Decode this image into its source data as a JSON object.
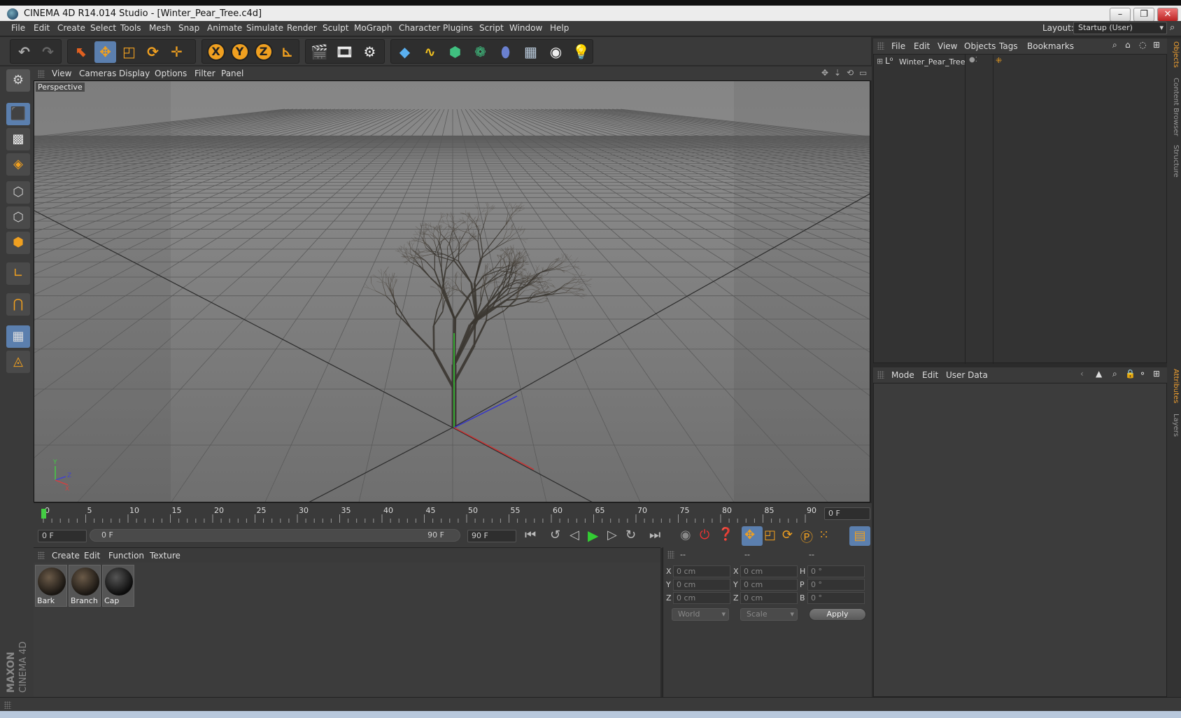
{
  "window": {
    "title": "CINEMA 4D R14.014 Studio - [Winter_Pear_Tree.c4d]",
    "controls": [
      "–",
      "❐",
      "✕"
    ]
  },
  "menu": [
    "File",
    "Edit",
    "Create",
    "Select",
    "Tools",
    "Mesh",
    "Snap",
    "Animate",
    "Simulate",
    "Render",
    "Sculpt",
    "MoGraph",
    "Character",
    "Plugins",
    "Script",
    "Window",
    "Help"
  ],
  "layout": {
    "label": "Layout:",
    "value": "Startup (User)"
  },
  "viewport": {
    "menu": [
      "View",
      "Cameras",
      "Display",
      "Options",
      "Filter",
      "Panel"
    ],
    "label": "Perspective",
    "axis_labels": {
      "y": "Y",
      "z": "Z",
      "x": "X"
    }
  },
  "timeline": {
    "ticks": [
      "0",
      "5",
      "10",
      "15",
      "20",
      "25",
      "30",
      "35",
      "40",
      "45",
      "50",
      "55",
      "60",
      "65",
      "70",
      "75",
      "80",
      "85",
      "90"
    ],
    "current_frame": "0 F",
    "start_field": "0 F",
    "range_start": "0 F",
    "range_end": "90 F",
    "end_field": "90 F"
  },
  "materials": {
    "menu": [
      "Create",
      "Edit",
      "Function",
      "Texture"
    ],
    "items": [
      {
        "name": "Bark"
      },
      {
        "name": "Branch"
      },
      {
        "name": "Cap"
      }
    ]
  },
  "coords": {
    "col_headers": [
      "--",
      "--",
      "--"
    ],
    "rows": [
      {
        "l1": "X",
        "v1": "0 cm",
        "l2": "X",
        "v2": "0 cm",
        "l3": "H",
        "v3": "0 °"
      },
      {
        "l1": "Y",
        "v1": "0 cm",
        "l2": "Y",
        "v2": "0 cm",
        "l3": "P",
        "v3": "0 °"
      },
      {
        "l1": "Z",
        "v1": "0 cm",
        "l2": "Z",
        "v2": "0 cm",
        "l3": "B",
        "v3": "0 °"
      }
    ],
    "space": "World",
    "mode": "Scale",
    "apply": "Apply"
  },
  "objects": {
    "menu": [
      "File",
      "Edit",
      "View",
      "Objects",
      "Tags",
      "Bookmarks"
    ],
    "items": [
      {
        "name": "Winter_Pear_Tree"
      }
    ]
  },
  "attributes": {
    "menu": [
      "Mode",
      "Edit",
      "User Data"
    ]
  },
  "right_tabs": [
    "Objects",
    "Content Browser",
    "Structure",
    "Attributes",
    "Layers"
  ],
  "branding": {
    "line1": "MAXON",
    "line2": "CINEMA 4D"
  },
  "colors": {
    "accent": "#5b7fae",
    "panel": "#3a3a3a",
    "active_tab": "#f0a030"
  }
}
